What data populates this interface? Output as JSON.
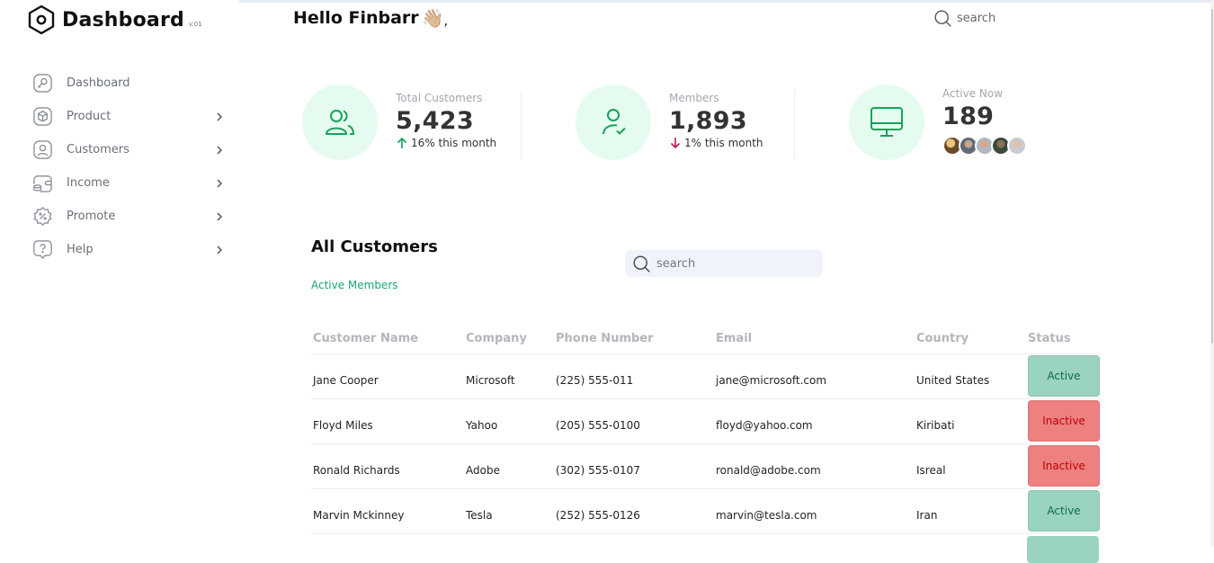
{
  "app": {
    "title": "Dashboard",
    "version": "v.01"
  },
  "sidebar": {
    "items": [
      {
        "label": "Dashboard",
        "icon": "key-icon",
        "has_chevron": false
      },
      {
        "label": "Product",
        "icon": "cube-icon",
        "has_chevron": true
      },
      {
        "label": "Customers",
        "icon": "user-square-icon",
        "has_chevron": true
      },
      {
        "label": "Income",
        "icon": "wallet-icon",
        "has_chevron": true
      },
      {
        "label": "Promote",
        "icon": "discount-badge-icon",
        "has_chevron": true
      },
      {
        "label": "Help",
        "icon": "help-message-icon",
        "has_chevron": true
      }
    ]
  },
  "header": {
    "greeting": "Hello Finbarr",
    "emoji": "👋🏼",
    "suffix": ",",
    "search_placeholder": "search"
  },
  "stats": [
    {
      "label": "Total Customers",
      "value": "5,423",
      "trend": "16% this month",
      "direction": "up",
      "icon": "users-icon"
    },
    {
      "label": "Members",
      "value": "1,893",
      "trend": "1% this month",
      "direction": "down",
      "icon": "user-check-icon"
    },
    {
      "label": "Active Now",
      "value": "189",
      "icon": "monitor-icon"
    }
  ],
  "colors": {
    "accent": "#17a673",
    "icon_bg": "#e6fbf0",
    "active_bg": "#9bd3c3",
    "active_text": "#0f6a4a",
    "inactive_bg": "#ee8080",
    "inactive_text": "#c00000",
    "trend_down": "#c2185b"
  },
  "customers": {
    "title": "All Customers",
    "subtitle": "Active Members",
    "search_placeholder": "search",
    "columns": [
      "Customer Name",
      "Company",
      "Phone Number",
      "Email",
      "Country",
      "Status"
    ],
    "rows": [
      {
        "name": "Jane Cooper",
        "company": "Microsoft",
        "phone": "(225) 555-011",
        "email": "jane@microsoft.com",
        "country": "United States",
        "status": "Active"
      },
      {
        "name": "Floyd Miles",
        "company": "Yahoo",
        "phone": "(205) 555-0100",
        "email": "floyd@yahoo.com",
        "country": "Kiribati",
        "status": "Inactive"
      },
      {
        "name": "Ronald Richards",
        "company": "Adobe",
        "phone": "(302) 555-0107",
        "email": "ronald@adobe.com",
        "country": "Isreal",
        "status": "Inactive"
      },
      {
        "name": "Marvin Mckinney",
        "company": "Tesla",
        "phone": "(252) 555-0126",
        "email": "marvin@tesla.com",
        "country": "Iran",
        "status": "Active"
      }
    ]
  }
}
